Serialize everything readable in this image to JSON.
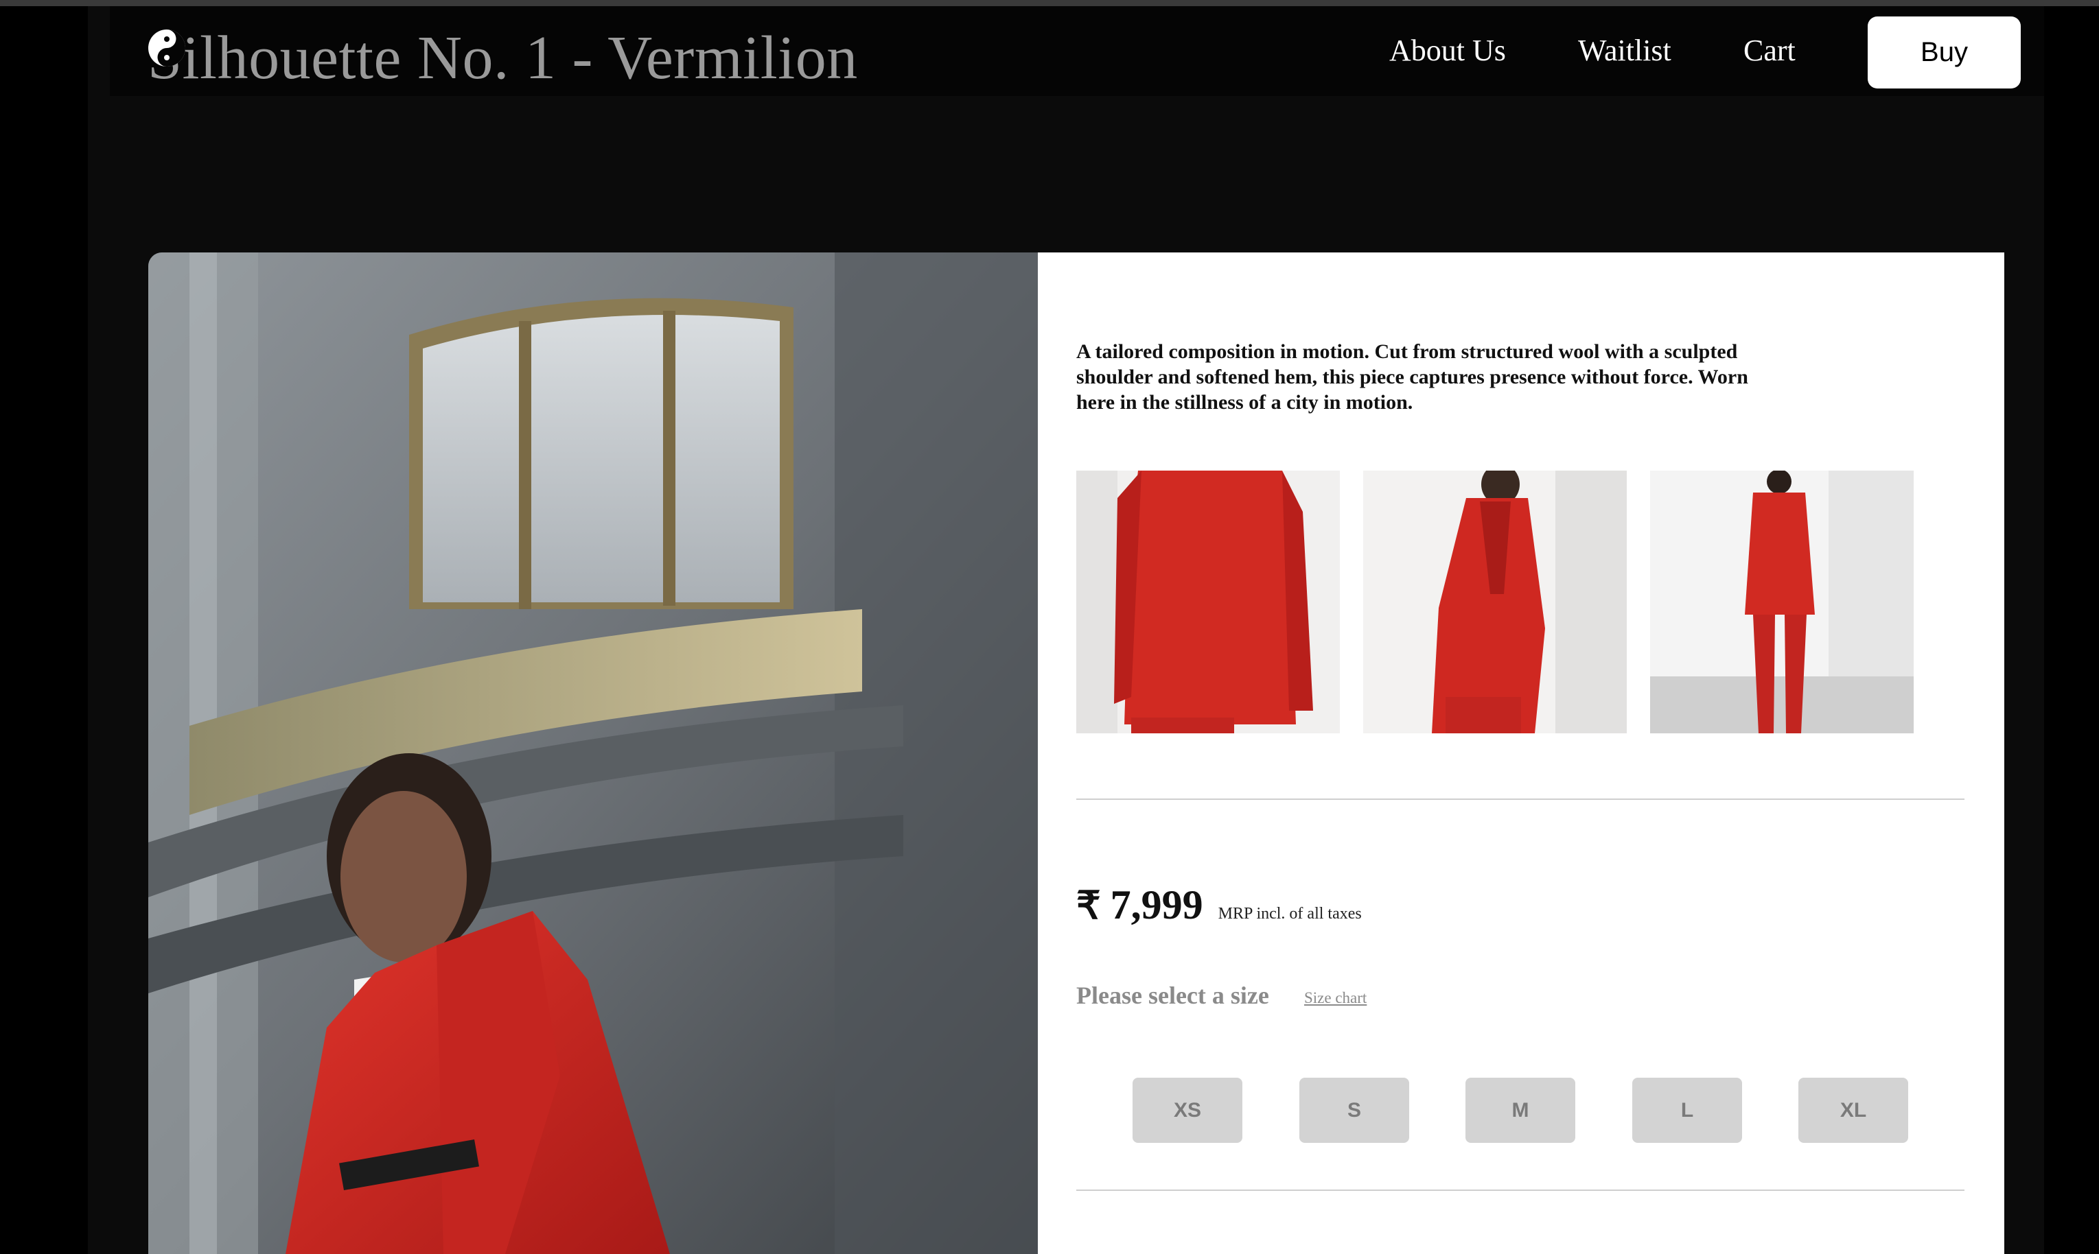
{
  "header": {
    "title": "Silhouette No. 1 - Vermilion",
    "nav": [
      "About Us",
      "Waitlist",
      "Cart"
    ],
    "buy_label": "Buy"
  },
  "product": {
    "description": "A tailored composition in motion. Cut from structured wool with a sculpted shoulder and softened hem, this piece captures presence without force. Worn here in the stillness of a city in motion.",
    "currency_symbol": "₹",
    "price": "7,999",
    "price_note": "MRP incl. of all taxes",
    "size_prompt": "Please select a size",
    "size_chart_label": "Size chart",
    "sizes": [
      "XS",
      "S",
      "M",
      "L",
      "XL"
    ]
  },
  "colors": {
    "accent_red": "#c8231f",
    "panel_bg": "#ffffff",
    "page_bg": "#0b0b0b"
  }
}
